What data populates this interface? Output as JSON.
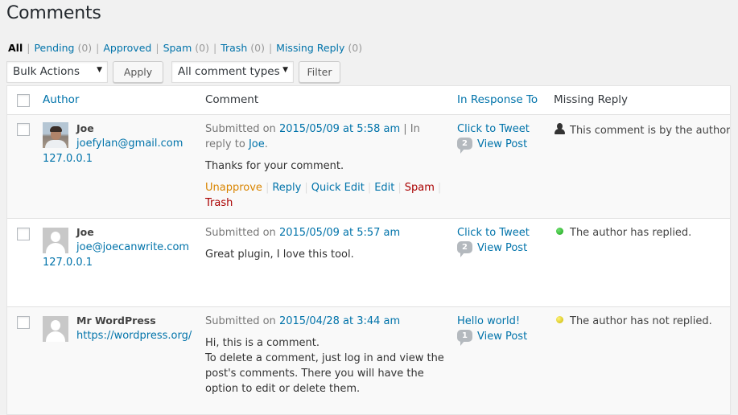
{
  "page": {
    "title": "Comments"
  },
  "filters": [
    {
      "label": "All",
      "count": "",
      "current": true
    },
    {
      "label": "Pending",
      "count": "(0)"
    },
    {
      "label": "Approved",
      "count": ""
    },
    {
      "label": "Spam",
      "count": "(0)"
    },
    {
      "label": "Trash",
      "count": "(0)"
    },
    {
      "label": "Missing Reply",
      "count": "(0)"
    }
  ],
  "filter_separator": "|",
  "tablenav": {
    "bulk_actions": "Bulk Actions",
    "apply": "Apply",
    "comment_types": "All comment types",
    "filter": "Filter",
    "dropdown_arrow": "▼"
  },
  "columns": {
    "author": "Author",
    "comment": "Comment",
    "in_response_to": "In Response To",
    "missing_reply": "Missing Reply"
  },
  "comments": [
    {
      "author_name": "Joe",
      "author_link": "joefylan@gmail.com",
      "author_ip": "127.0.0.1",
      "avatar": "photo",
      "submitted_prefix": "Submitted on",
      "submitted_date": "2015/05/09 at 5:58 am",
      "in_reply_prefix": "| In reply to",
      "in_reply_to": "Joe",
      "in_reply_suffix": ".",
      "text": [
        "Thanks for your comment."
      ],
      "actions": [
        "Unapprove",
        "Reply",
        "Quick Edit",
        "Edit",
        "Spam",
        "Trash"
      ],
      "response_post": "Click to Tweet",
      "comment_count": "2",
      "view_post": "View Post",
      "status_icon": "user-icon",
      "status_text": "This comment is by the author."
    },
    {
      "author_name": "Joe",
      "author_link": "joe@joecanwrite.com",
      "author_ip": "127.0.0.1",
      "avatar": "default",
      "submitted_prefix": "Submitted on",
      "submitted_date": "2015/05/09 at 5:57 am",
      "text": [
        "Great plugin, I love this tool."
      ],
      "response_post": "Click to Tweet",
      "comment_count": "2",
      "view_post": "View Post",
      "status_icon": "green-dot-icon",
      "status_color": "#1aa31a",
      "status_text": "The author has replied."
    },
    {
      "author_name": "Mr WordPress",
      "author_link": "https://wordpress.org/",
      "avatar": "default",
      "submitted_prefix": "Submitted on",
      "submitted_date": "2015/04/28 at 3:44 am",
      "text": [
        "Hi, this is a comment.",
        "To delete a comment, just log in and view the post's comments. There you will have the option to edit or delete them."
      ],
      "response_post": "Hello world!",
      "comment_count": "1",
      "view_post": "View Post",
      "status_icon": "yellow-dot-icon",
      "status_color": "#c9b800",
      "status_text": "The author has not replied."
    }
  ],
  "colors": {
    "link": "#0073aa",
    "unapprove": "#d98500",
    "danger": "#aa0000",
    "background": "#f1f1f1"
  }
}
